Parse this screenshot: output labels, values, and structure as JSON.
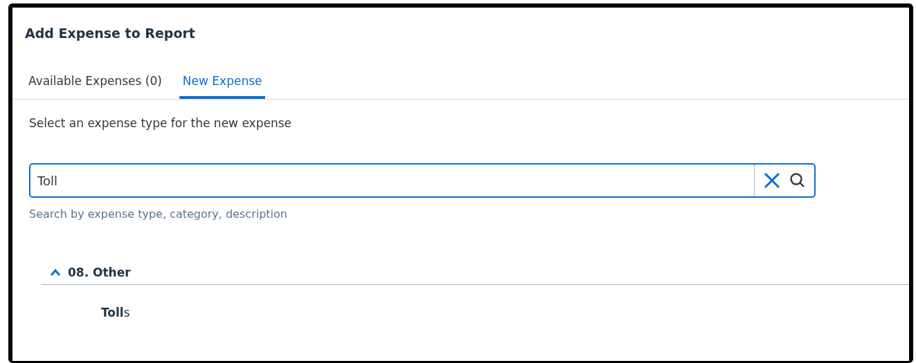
{
  "dialog": {
    "title": "Add Expense to Report"
  },
  "tabs": [
    {
      "label": "Available Expenses (0)",
      "selected": false
    },
    {
      "label": "New Expense",
      "selected": true
    }
  ],
  "instruction": "Select an expense type for the new expense",
  "search": {
    "value": "Toll",
    "hint": "Search by expense type, category, description"
  },
  "groups": [
    {
      "label": "08. Other",
      "expanded": true,
      "items": [
        "**Toll**s"
      ]
    }
  ]
}
